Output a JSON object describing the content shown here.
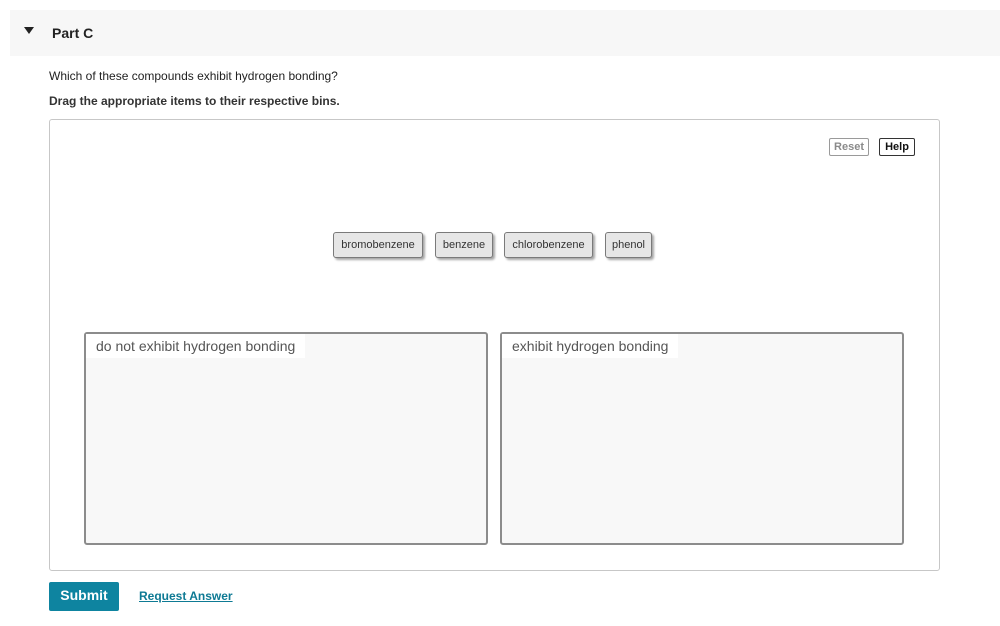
{
  "part": {
    "title": "Part C",
    "caret_icon": "caret-down-icon"
  },
  "question": "Which of these compounds exhibit hydrogen bonding?",
  "instruction": "Drag the appropriate items to their respective bins.",
  "toolbar": {
    "reset_label": "Reset",
    "help_label": "Help"
  },
  "tokens": [
    {
      "label": "bromobenzene"
    },
    {
      "label": "benzene"
    },
    {
      "label": "chlorobenzene"
    },
    {
      "label": "phenol"
    }
  ],
  "bins": [
    {
      "label": "do not exhibit hydrogen bonding"
    },
    {
      "label": "exhibit hydrogen bonding"
    }
  ],
  "actions": {
    "submit_label": "Submit",
    "request_answer_label": "Request Answer"
  },
  "colors": {
    "submit_bg": "#0e84a0",
    "link": "#0e7a94",
    "header_bg": "#f7f7f7"
  }
}
